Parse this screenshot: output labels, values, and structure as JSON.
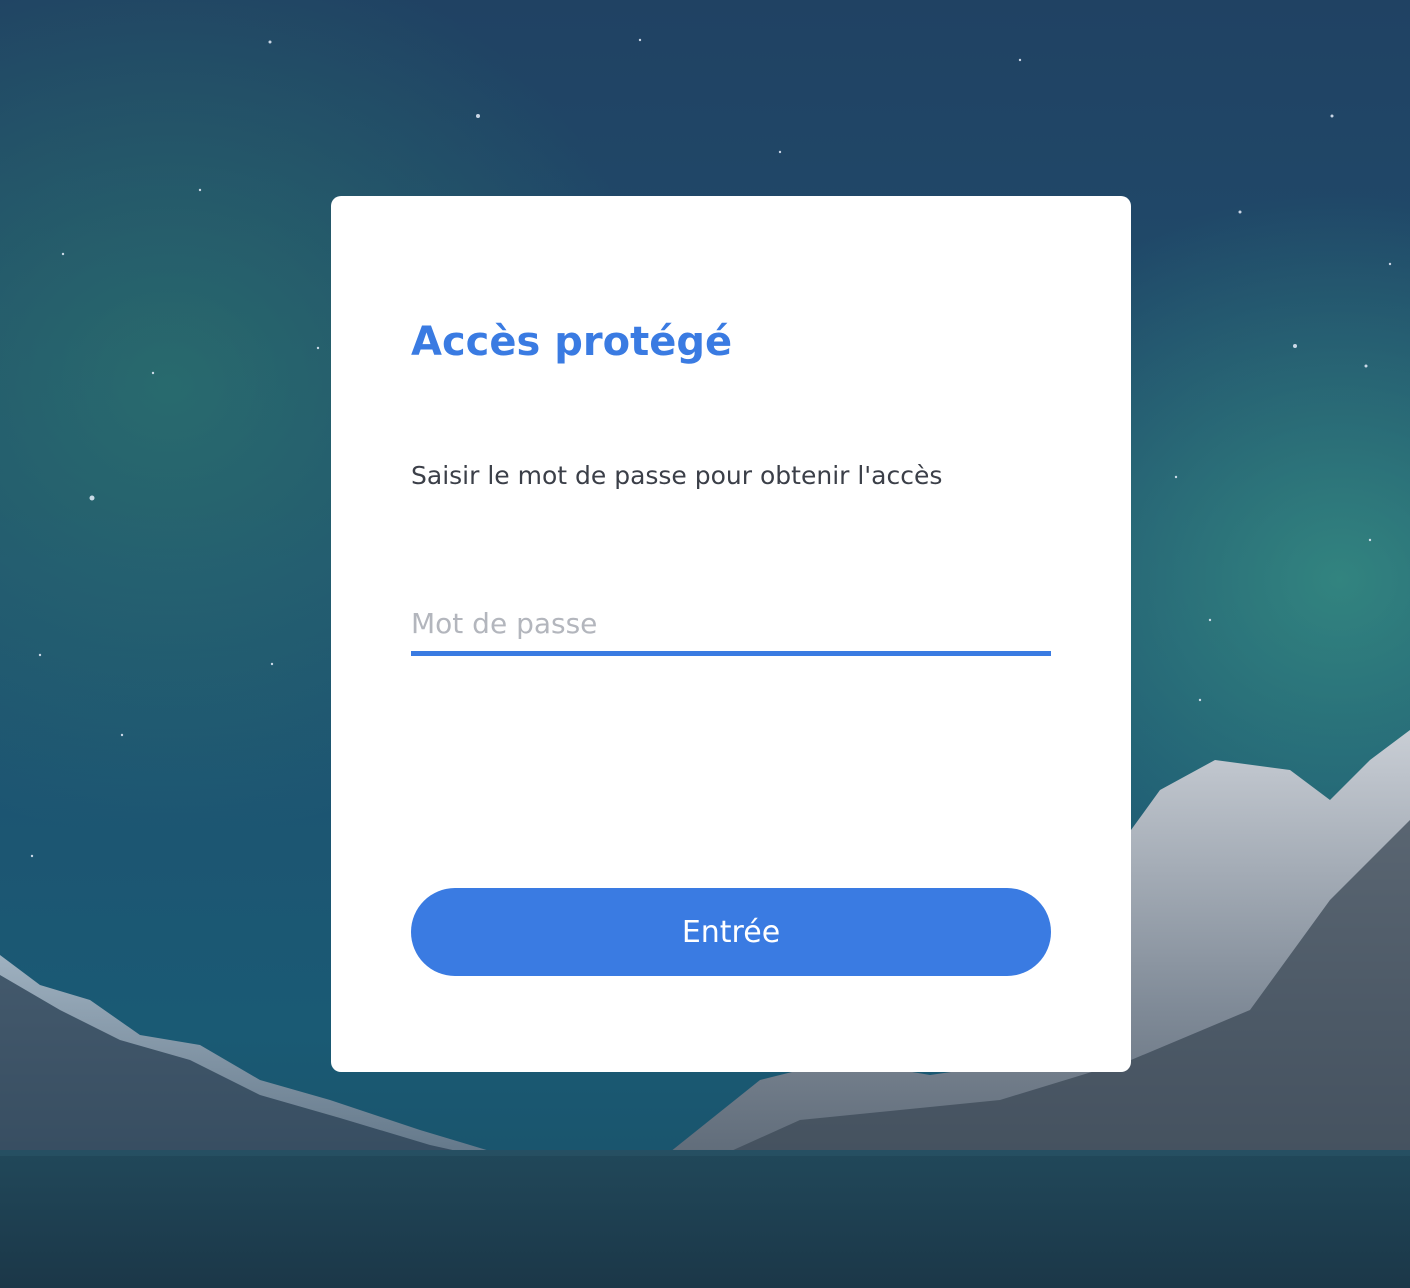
{
  "card": {
    "title": "Accès protégé",
    "description": "Saisir le mot de passe pour obtenir l'accès",
    "password": {
      "value": "",
      "placeholder": "Mot de passe"
    },
    "submit_label": "Entrée"
  },
  "colors": {
    "accent": "#3a7be2",
    "text": "#3b3f48",
    "placeholder": "#b3b6bd",
    "card_background": "#ffffff"
  }
}
